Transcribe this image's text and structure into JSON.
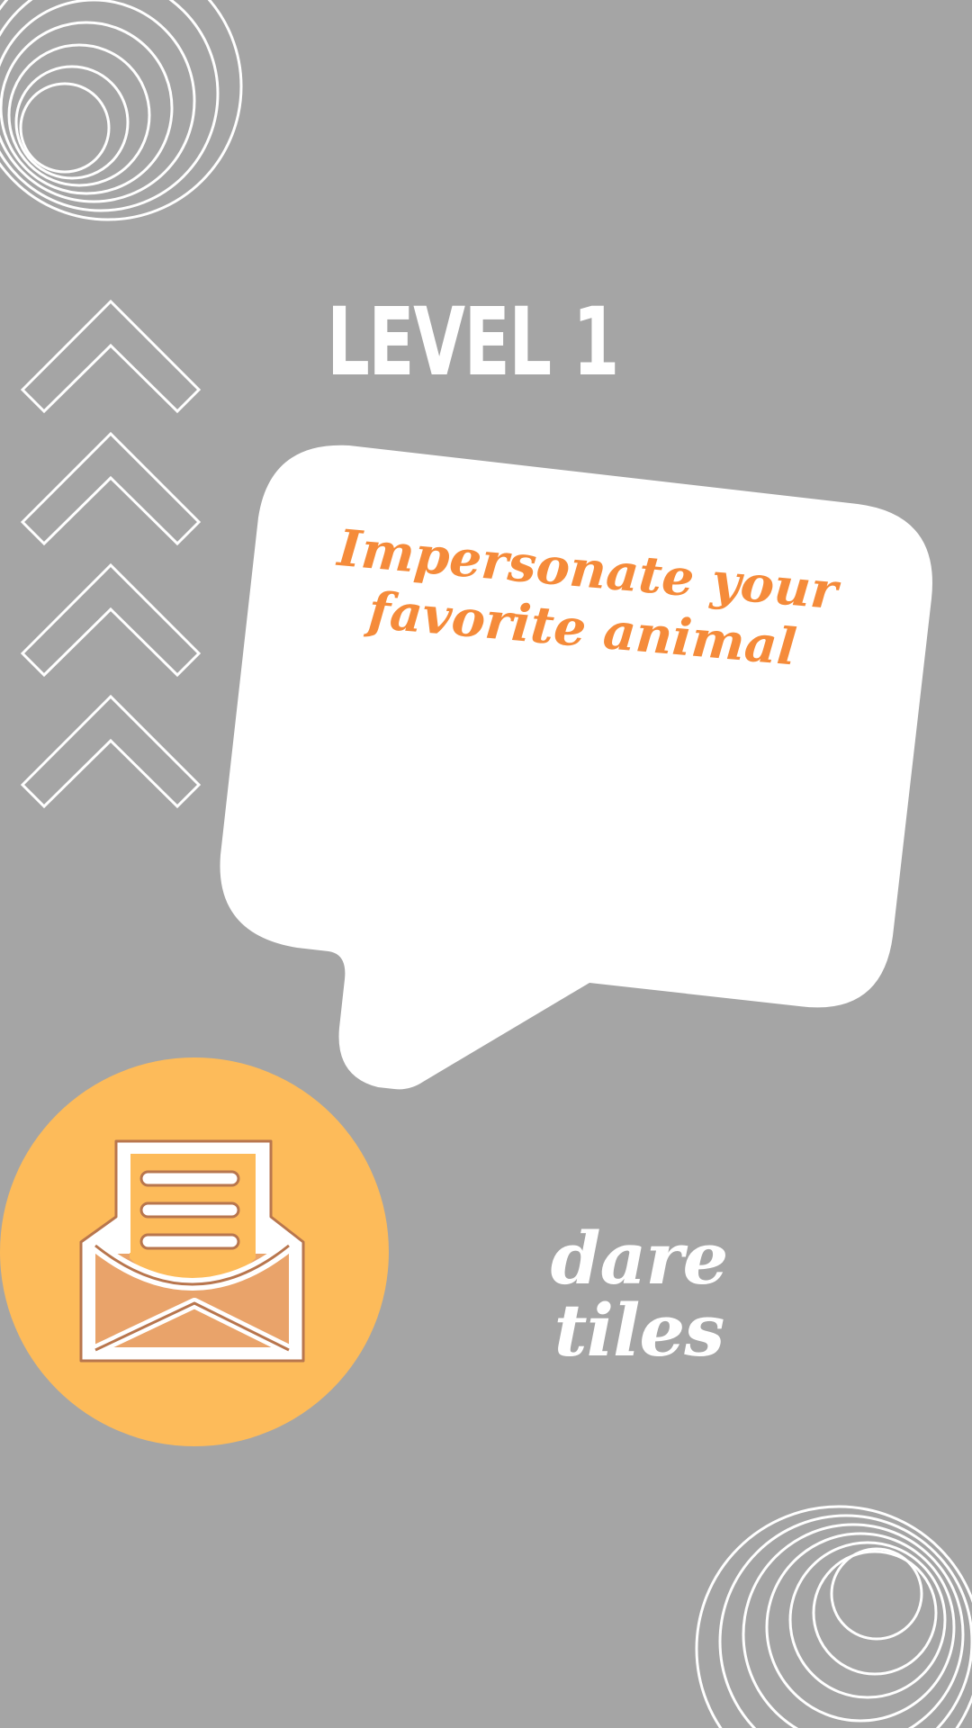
{
  "level": {
    "title": "LEVEL 1"
  },
  "dare": {
    "prompt": "Impersonate your favorite animal"
  },
  "brand": {
    "name": "dare tiles"
  },
  "icons": {
    "envelope": "open-envelope-letter-icon",
    "chevrons": "chevron-up-outline-icon",
    "circles": "concentric-circles-decoration"
  },
  "colors": {
    "background": "#a5a5a5",
    "bubble": "#ffffff",
    "accent": "#f58b3a",
    "badge": "#fdbb5a",
    "icon_stroke": "#b8764e",
    "line": "#ffffff"
  }
}
